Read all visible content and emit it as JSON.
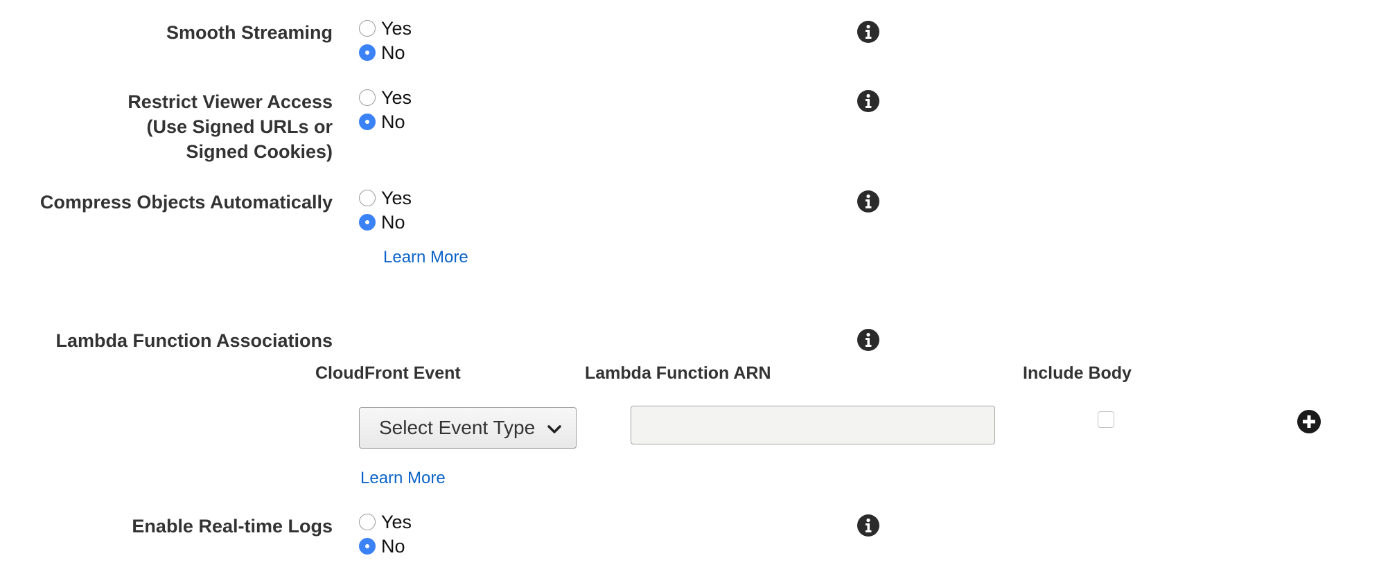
{
  "smooth_streaming": {
    "label": "Smooth Streaming",
    "options": [
      {
        "label": "Yes",
        "checked": false
      },
      {
        "label": "No",
        "checked": true
      }
    ]
  },
  "restrict_viewer_access": {
    "label_lines": [
      "Restrict Viewer Access",
      "(Use Signed URLs or",
      "Signed Cookies)"
    ],
    "options": [
      {
        "label": "Yes",
        "checked": false
      },
      {
        "label": "No",
        "checked": true
      }
    ]
  },
  "compress_objects": {
    "label": "Compress Objects Automatically",
    "options": [
      {
        "label": "Yes",
        "checked": false
      },
      {
        "label": "No",
        "checked": true
      }
    ],
    "learn_more": "Learn More"
  },
  "lambda_associations": {
    "label": "Lambda Function Associations",
    "columns": [
      "CloudFront Event",
      "Lambda Function ARN",
      "Include Body"
    ],
    "select_value": "Select Event Type",
    "arn_value": "",
    "include_body": false,
    "learn_more": "Learn More"
  },
  "realtime_logs": {
    "label": "Enable Real-time Logs",
    "options": [
      {
        "label": "Yes",
        "checked": false
      },
      {
        "label": "No",
        "checked": true
      }
    ]
  },
  "icons": {
    "info": "info-icon",
    "add": "plus-circle-icon",
    "chevron": "chevron-down-icon"
  },
  "colors": {
    "accent": "#3b82f6",
    "link": "#0b63c7",
    "label": "#333333"
  }
}
